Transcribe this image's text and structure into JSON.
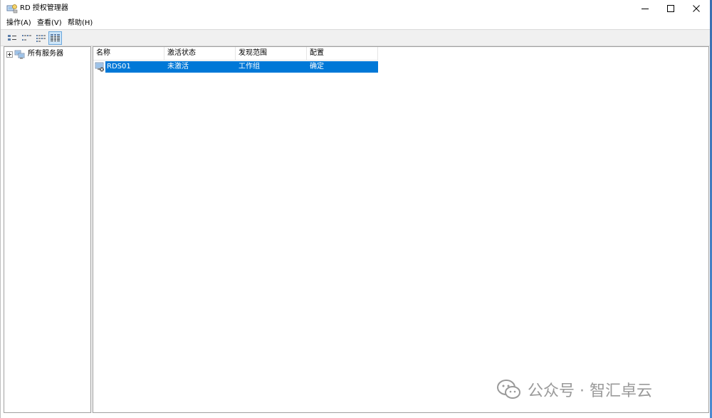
{
  "window": {
    "title": "RD 授权管理器",
    "icon": "rd-licensing-icon"
  },
  "window_controls": [
    "minimize-icon",
    "maximize-icon",
    "close-icon"
  ],
  "menu": {
    "items": [
      {
        "label": "操作(A)"
      },
      {
        "label": "查看(V)"
      },
      {
        "label": "帮助(H)"
      }
    ]
  },
  "toolbar": {
    "buttons": [
      {
        "icon": "large-icons-view-icon",
        "active": false
      },
      {
        "icon": "small-icons-view-icon",
        "active": false
      },
      {
        "icon": "list-view-icon",
        "active": false
      },
      {
        "icon": "details-view-icon",
        "active": true
      }
    ]
  },
  "tree": {
    "root_label": "所有服务器",
    "root_icon": "servers-group-icon"
  },
  "list": {
    "columns": [
      "名称",
      "激活状态",
      "发现范围",
      "配置"
    ],
    "rows": [
      {
        "name": "RDS01",
        "activation": "未激活",
        "scope": "工作组",
        "config": "确定",
        "icon": "server-warning-icon",
        "selected": true
      }
    ]
  },
  "watermark": {
    "text": "公众号 · 智汇卓云",
    "icon": "wechat-icon"
  },
  "colors": {
    "selection": "#0078d7",
    "toolbar_bg": "#f0f0f0",
    "border": "#a0a0a0"
  }
}
